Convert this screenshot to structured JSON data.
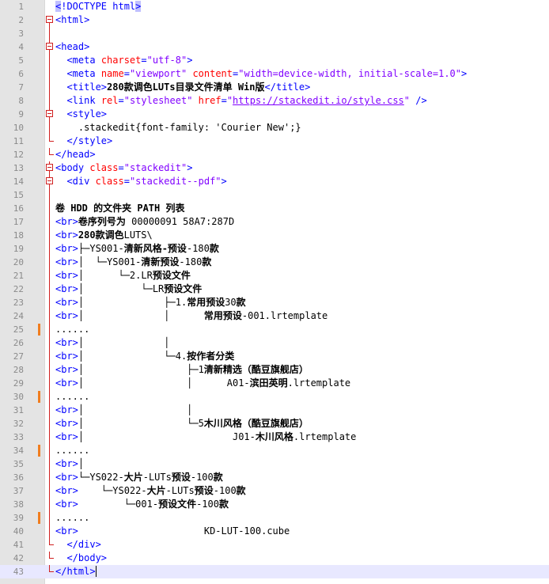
{
  "editor": {
    "title": "280款调色LUTs目录文件清单 Win版",
    "lines": [
      {
        "n": "1",
        "h": "<span class=\"tg sel\">&lt;</span><span class=\"tg\">!DOCTYPE html</span><span class=\"tg sel\">&gt;</span>"
      },
      {
        "n": "2",
        "fold": "box",
        "h": "<span class=\"tg\">&lt;html&gt;</span>"
      },
      {
        "n": "3",
        "fold": "line",
        "h": ""
      },
      {
        "n": "4",
        "fold": "box",
        "h": "<span class=\"tg\">&lt;head&gt;</span>"
      },
      {
        "n": "5",
        "fold": "line",
        "h": "  <span class=\"tg\">&lt;meta </span><span class=\"at\">charset</span><span class=\"tg\">=</span><span class=\"av\">\"utf-8\"</span><span class=\"tg\">&gt;</span>"
      },
      {
        "n": "6",
        "fold": "line",
        "h": "  <span class=\"tg\">&lt;meta </span><span class=\"at\">name</span><span class=\"tg\">=</span><span class=\"av\">\"viewport\"</span> <span class=\"at\">content</span><span class=\"tg\">=</span><span class=\"av\">\"width=device-width, initial-scale=1.0\"</span><span class=\"tg\">&gt;</span>"
      },
      {
        "n": "7",
        "fold": "line",
        "h": "  <span class=\"tg\">&lt;title&gt;</span><span class=\"bd\">280款调色LUTs目录文件清单 Win版</span><span class=\"tg\">&lt;/title&gt;</span>"
      },
      {
        "n": "8",
        "fold": "line",
        "h": "  <span class=\"tg\">&lt;link </span><span class=\"at\">rel</span><span class=\"tg\">=</span><span class=\"av\">\"stylesheet\"</span> <span class=\"at\">href</span><span class=\"tg\">=</span><span class=\"av\">\"</span><span class=\"url\">https://stackedit.io/style.css</span><span class=\"av\">\"</span> <span class=\"tg\">/&gt;</span>"
      },
      {
        "n": "9",
        "fold": "box",
        "h": "  <span class=\"tg\">&lt;style&gt;</span>"
      },
      {
        "n": "10",
        "fold": "line",
        "h": "    .stackedit{font-family: 'Courier New';}"
      },
      {
        "n": "11",
        "fold": "end",
        "h": "  <span class=\"tg\">&lt;/style&gt;</span>"
      },
      {
        "n": "12",
        "fold": "end",
        "h": "<span class=\"tg\">&lt;/head&gt;</span>"
      },
      {
        "n": "13",
        "fold": "box",
        "h": "<span class=\"tg\">&lt;body </span><span class=\"at\">class</span><span class=\"tg\">=</span><span class=\"av\">\"stackedit\"</span><span class=\"tg\">&gt;</span>"
      },
      {
        "n": "14",
        "fold": "box",
        "h": "  <span class=\"tg\">&lt;div </span><span class=\"at\">class</span><span class=\"tg\">=</span><span class=\"av\">\"stackedit--pdf\"</span><span class=\"tg\">&gt;</span>"
      },
      {
        "n": "15",
        "fold": "line",
        "h": ""
      },
      {
        "n": "16",
        "fold": "line",
        "h": "<span class=\"bd\">卷 HDD 的文件夹 PATH 列表</span>"
      },
      {
        "n": "17",
        "fold": "line",
        "h": "<span class=\"tg\">&lt;br&gt;</span><span class=\"bd\">卷序列号为</span> 00000091 58A7:287D"
      },
      {
        "n": "18",
        "fold": "line",
        "h": "<span class=\"tg\">&lt;br&gt;</span><span class=\"bd\">280款调色</span>LUTS\\"
      },
      {
        "n": "19",
        "fold": "line",
        "h": "<span class=\"tg\">&lt;br&gt;</span>├─YS001-<span class=\"bd\">清新风格-预设</span>-180<span class=\"bd\">款</span>"
      },
      {
        "n": "20",
        "fold": "line",
        "h": "<span class=\"tg\">&lt;br&gt;</span>│  └─YS001-<span class=\"bd\">清新预设</span>-180<span class=\"bd\">款</span>"
      },
      {
        "n": "21",
        "fold": "line",
        "h": "<span class=\"tg\">&lt;br&gt;</span>│      └─2.LR<span class=\"bd\">预设文件</span>"
      },
      {
        "n": "22",
        "fold": "line",
        "h": "<span class=\"tg\">&lt;br&gt;</span>│          └─LR<span class=\"bd\">预设文件</span>"
      },
      {
        "n": "23",
        "fold": "line",
        "h": "<span class=\"tg\">&lt;br&gt;</span>│              ├─1.<span class=\"bd\">常用预设</span>30<span class=\"bd\">款</span>"
      },
      {
        "n": "24",
        "fold": "line",
        "h": "<span class=\"tg\">&lt;br&gt;</span>│              │      <span class=\"bd\">常用预设</span>-001.lrtemplate"
      },
      {
        "n": "25",
        "fold": "line",
        "mark": true,
        "h": "......"
      },
      {
        "n": "26",
        "fold": "line",
        "h": "<span class=\"tg\">&lt;br&gt;</span>│              │"
      },
      {
        "n": "27",
        "fold": "line",
        "h": "<span class=\"tg\">&lt;br&gt;</span>│              └─4.<span class=\"bd\">按作者分类</span>"
      },
      {
        "n": "28",
        "fold": "line",
        "h": "<span class=\"tg\">&lt;br&gt;</span>│                  ├─1<span class=\"bd\">清新精选（酷豆旗舰店）</span>"
      },
      {
        "n": "29",
        "fold": "line",
        "h": "<span class=\"tg\">&lt;br&gt;</span>│                  │      A01-<span class=\"bd\">滨田英明</span>.lrtemplate"
      },
      {
        "n": "30",
        "fold": "line",
        "mark": true,
        "h": "......"
      },
      {
        "n": "31",
        "fold": "line",
        "h": "<span class=\"tg\">&lt;br&gt;</span>│                  │"
      },
      {
        "n": "32",
        "fold": "line",
        "h": "<span class=\"tg\">&lt;br&gt;</span>│                  └─5<span class=\"bd\">木川风格（酷豆旗舰店）</span>"
      },
      {
        "n": "33",
        "fold": "line",
        "h": "<span class=\"tg\">&lt;br&gt;</span>│                          J01-<span class=\"bd\">木川风格</span>.lrtemplate"
      },
      {
        "n": "34",
        "fold": "line",
        "mark": true,
        "h": "......"
      },
      {
        "n": "35",
        "fold": "line",
        "h": "<span class=\"tg\">&lt;br&gt;</span>│"
      },
      {
        "n": "36",
        "fold": "line",
        "h": "<span class=\"tg\">&lt;br&gt;</span>└─YS022-<span class=\"bd\">大片</span>-LUTs<span class=\"bd\">预设</span>-100<span class=\"bd\">款</span>"
      },
      {
        "n": "37",
        "fold": "line",
        "h": "<span class=\"tg\">&lt;br&gt;</span>    └─YS022-<span class=\"bd\">大片</span>-LUTs<span class=\"bd\">预设</span>-100<span class=\"bd\">款</span>"
      },
      {
        "n": "38",
        "fold": "line",
        "h": "<span class=\"tg\">&lt;br&gt;</span>        └─001-<span class=\"bd\">预设文件</span>-100<span class=\"bd\">款</span>"
      },
      {
        "n": "39",
        "fold": "line",
        "mark": true,
        "h": "......"
      },
      {
        "n": "40",
        "fold": "line",
        "h": "<span class=\"tg\">&lt;br&gt;</span>                      KD-LUT-100.cube"
      },
      {
        "n": "41",
        "fold": "end",
        "h": "  <span class=\"tg\">&lt;/div&gt;</span>"
      },
      {
        "n": "42",
        "fold": "end",
        "h": "  <span class=\"tg\">&lt;/body&gt;</span>"
      },
      {
        "n": "43",
        "fold": "end",
        "current": true,
        "h": "<span class=\"tg\">&lt;/html&gt;</span><span class=\"caret\"></span>"
      }
    ]
  }
}
